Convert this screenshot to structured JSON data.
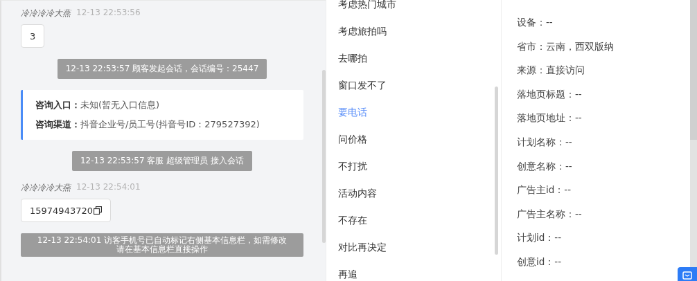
{
  "chat": [
    {
      "kind": "message",
      "sender": "冷冷冷冷大燕",
      "time": "12-13 22:53:56",
      "text": "3",
      "copyable": false
    },
    {
      "kind": "notice",
      "text": "12-13 22:53:57 顾客发起会话，会话编号：25447"
    },
    {
      "kind": "info",
      "rows": [
        {
          "label": "咨询入口：",
          "value": "未知(暂无入口信息)"
        },
        {
          "label": "咨询渠道：",
          "value": "抖音企业号/员工号(抖音号ID：279527392)"
        }
      ]
    },
    {
      "kind": "notice",
      "text": "12-13 22:53:57 客服 超级管理员 接入会话"
    },
    {
      "kind": "message",
      "sender": "冷冷冷冷大燕",
      "time": "12-13 22:54:01",
      "text": "15974943720",
      "copyable": true
    },
    {
      "kind": "notice",
      "text": "12-13 22:54:01 访客手机号已自动标记右侧基本信息栏，如需修改请在基本信息栏直接操作"
    }
  ],
  "quick_replies": [
    {
      "label": "考虑热门城市",
      "selected": false
    },
    {
      "label": "考虑旅拍吗",
      "selected": false
    },
    {
      "label": "去哪拍",
      "selected": false
    },
    {
      "label": "窗口发不了",
      "selected": false
    },
    {
      "label": "要电话",
      "selected": true
    },
    {
      "label": "问价格",
      "selected": false
    },
    {
      "label": "不打扰",
      "selected": false
    },
    {
      "label": "活动内容",
      "selected": false
    },
    {
      "label": "不存在",
      "selected": false
    },
    {
      "label": "对比再决定",
      "selected": false
    },
    {
      "label": "再追",
      "selected": false
    }
  ],
  "visitor_info": [
    "设备：--",
    "省市：云南，西双版纳",
    "来源：直接访问",
    "落地页标题：--",
    "落地页地址：--",
    "计划名称：--",
    "创意名称：--",
    "广告主id：--",
    "广告主名称：--",
    "计划id：--",
    "创意id：--"
  ]
}
